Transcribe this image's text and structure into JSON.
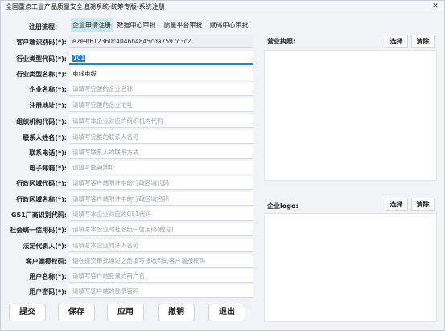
{
  "window": {
    "title": "全国重点工业产品质量安全追溯系统-统筹专版-系统注册",
    "close_glyph": "✕"
  },
  "tabs": {
    "label": "注册流程:",
    "items": [
      {
        "label": "企业申请注册",
        "active": true
      },
      {
        "label": "数据中心审批",
        "active": false
      },
      {
        "label": "质量平台审批",
        "active": false
      },
      {
        "label": "赋码中心审批",
        "active": false
      }
    ]
  },
  "form": {
    "client_id": {
      "label": "客户端识别码(*):",
      "value": "e2e9f612360c4046b4845cda7597c3c2"
    },
    "industry_code": {
      "label": "行业类型代码(*):",
      "value": "101"
    },
    "industry_name": {
      "label": "行业类型名称(*):",
      "value": "电线电缆"
    },
    "company_name": {
      "label": "企业名称(*):",
      "placeholder": "请填写完整的企业名称"
    },
    "address": {
      "label": "注册地址(*):",
      "placeholder": "请填写完整的企业地址"
    },
    "org_code": {
      "label": "组织机构代码(*):",
      "placeholder": "请填写本企业对应的组织机构代码"
    },
    "contact_name": {
      "label": "联系人姓名(*):",
      "placeholder": "请填写完整的联系人名称"
    },
    "contact_phone": {
      "label": "联系电话(*):",
      "placeholder": "请填写联系人的联系方式"
    },
    "email": {
      "label": "电子邮箱(*):",
      "placeholder": "请填写邮箱地址"
    },
    "region_code": {
      "label": "行政区域代码(*):",
      "placeholder": "请填写客户端附件中的行政区域代码"
    },
    "region_name": {
      "label": "行政区域名称(*):",
      "placeholder": "请填写客户端附件中的行政区域名称"
    },
    "gs1_code": {
      "label": "GS1厂商识别代码:",
      "placeholder": "请填写本企业对应的GS1代码"
    },
    "credit_code": {
      "label": "社会统一信用码(*):",
      "placeholder": "请填写本企业的社会统一信用码(税号)"
    },
    "legal_rep": {
      "label": "法定代表人(*):",
      "placeholder": "请填写本企业的法人名称"
    },
    "auth_code": {
      "label": "客户端授权码:",
      "placeholder": "请在提交审批通过之后填写接收到的客户端授权码"
    },
    "username": {
      "label": "用户名称(*):",
      "placeholder": "请填写客户端登录的用户名"
    },
    "password": {
      "label": "用户密码(*):",
      "placeholder": "请填写客户端的登录密码"
    }
  },
  "license": {
    "label": "营业执照:",
    "select_label": "选择",
    "clear_label": "清除"
  },
  "logo": {
    "label": "企业logo:",
    "select_label": "选择",
    "clear_label": "清除"
  },
  "actions": {
    "submit": "提交",
    "save": "保存",
    "apply": "应用",
    "undo": "撤销",
    "exit": "退出"
  },
  "colors": {
    "active_tab": "#c9e8f0",
    "focus_accent": "#2f7fc9",
    "placeholder": "#9aa0a8"
  }
}
